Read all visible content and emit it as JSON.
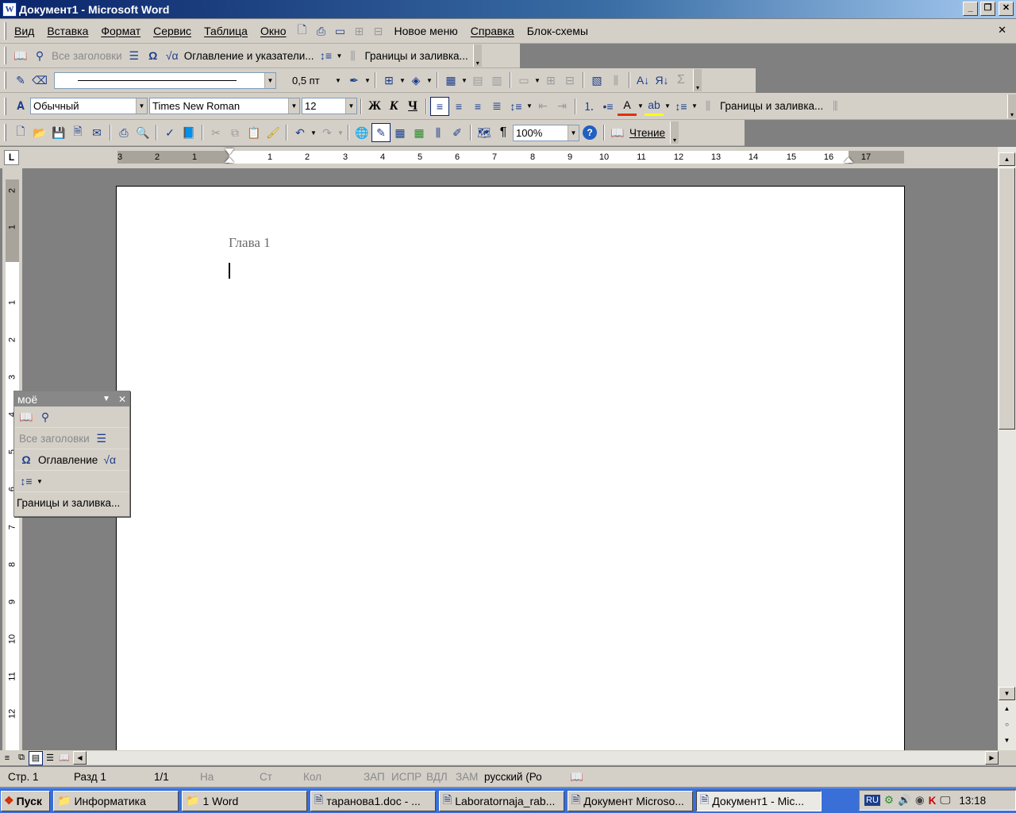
{
  "window": {
    "title": "Документ1 - Microsoft Word",
    "app_icon": "W",
    "minimize": "_",
    "restore": "❐",
    "close": "✕"
  },
  "menu": {
    "items": [
      "Вид",
      "Вставка",
      "Формат",
      "Сервис",
      "Таблица",
      "Окно"
    ],
    "extra": [
      "Новое меню",
      "Справка",
      "Блок-схемы"
    ],
    "close": "✕"
  },
  "toolbar1": {
    "all_headings": "Все заголовки",
    "toc": "Оглавление и указатели...",
    "borders": "Границы и заливка..."
  },
  "toolbar2": {
    "line_weight": "0,5 пт"
  },
  "formatting": {
    "style": "Обычный",
    "font": "Times New Roman",
    "size": "12",
    "bold": "Ж",
    "italic": "К",
    "underline": "Ч",
    "sigma": "Σ",
    "borders": "Границы и заливка..."
  },
  "standard": {
    "zoom": "100%",
    "reading": "Чтение",
    "pilcrow": "¶"
  },
  "ruler": {
    "tab_selector": "L",
    "marks_left": [
      "3",
      "2",
      "1"
    ],
    "marks_right": [
      "1",
      "2",
      "3",
      "4",
      "5",
      "6",
      "7",
      "8",
      "9",
      "10",
      "11",
      "12",
      "13",
      "14",
      "15",
      "16",
      "17"
    ],
    "vmarks": [
      "2",
      "1",
      "1",
      "2",
      "3",
      "4",
      "5",
      "6",
      "7",
      "8",
      "9",
      "10",
      "11",
      "12"
    ]
  },
  "document": {
    "heading": "Глава 1"
  },
  "floating_toolbar": {
    "title": "моё",
    "all_headings": "Все заголовки",
    "toc": "Оглавление",
    "borders": "Границы и заливка..."
  },
  "statusbar": {
    "page": "Стр.  1",
    "section": "Разд  1",
    "pages": "1/1",
    "at": "На",
    "line": "Ст",
    "col": "Кол",
    "rec": "ЗАП",
    "trk": "ИСПР",
    "ext": "ВДЛ",
    "ovr": "ЗАМ",
    "lang": "русский (Ро"
  },
  "taskbar": {
    "start": "Пуск",
    "tasks": [
      "Информатика",
      "1 Word",
      "таранова1.doc - ...",
      "Laboratornaja_rab...",
      "Документ Microso...",
      "Документ1 - Mic..."
    ],
    "lang": "RU",
    "clock": "13:18"
  }
}
